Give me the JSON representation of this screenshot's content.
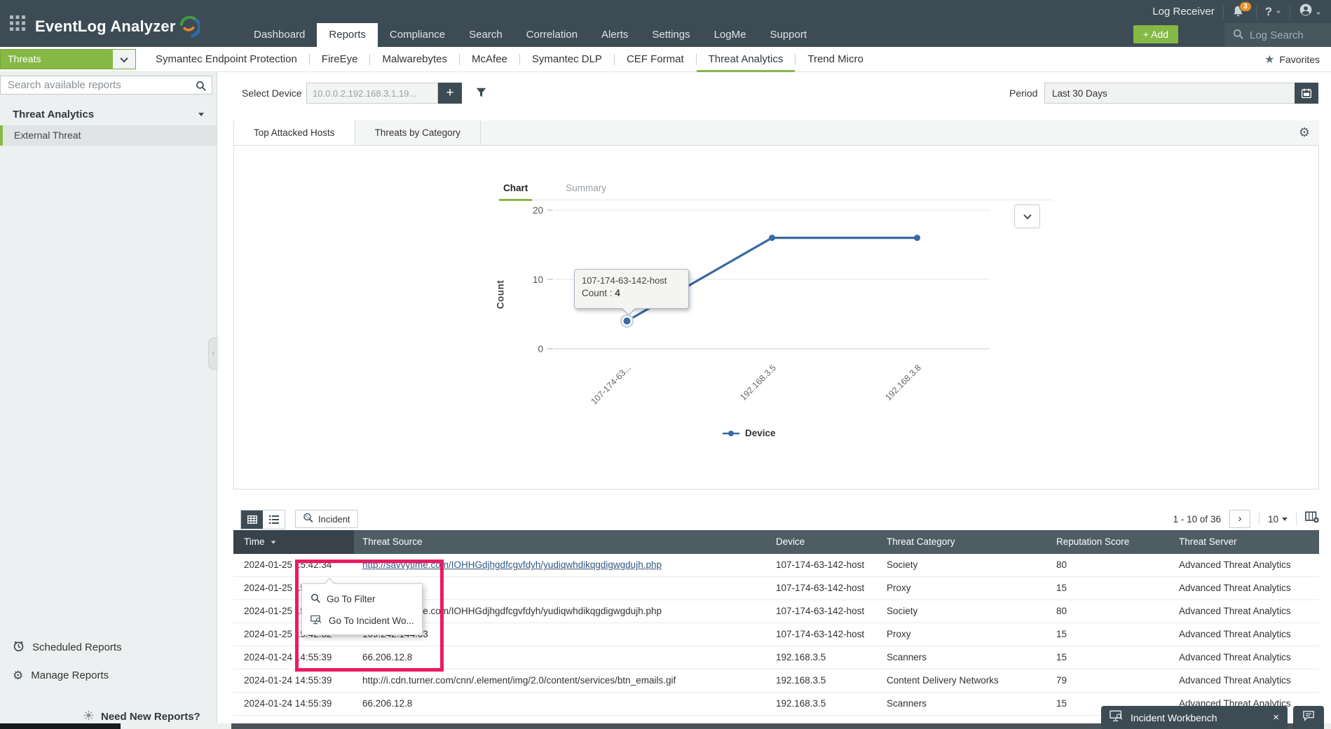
{
  "topbar": {
    "app_title": "EventLog Analyzer",
    "nav": [
      {
        "label": "Dashboard",
        "active": false
      },
      {
        "label": "Reports",
        "active": true
      },
      {
        "label": "Compliance",
        "active": false
      },
      {
        "label": "Search",
        "active": false
      },
      {
        "label": "Correlation",
        "active": false
      },
      {
        "label": "Alerts",
        "active": false
      },
      {
        "label": "Settings",
        "active": false
      },
      {
        "label": "LogMe",
        "active": false
      },
      {
        "label": "Support",
        "active": false
      }
    ],
    "log_receiver_label": "Log Receiver",
    "notification_count": "3",
    "help_label": "?",
    "add_label": "+  Add",
    "log_search_label": "Log Search"
  },
  "report_nav": {
    "selector_label": "Threats",
    "items": [
      {
        "label": "Symantec Endpoint Protection",
        "active": false
      },
      {
        "label": "FireEye",
        "active": false
      },
      {
        "label": "Malwarebytes",
        "active": false
      },
      {
        "label": "McAfee",
        "active": false
      },
      {
        "label": "Symantec DLP",
        "active": false
      },
      {
        "label": "CEF Format",
        "active": false
      },
      {
        "label": "Threat Analytics",
        "active": true
      },
      {
        "label": "Trend Micro",
        "active": false
      }
    ],
    "favorites_label": "Favorites",
    "star_icon": "★"
  },
  "sidebar": {
    "search_placeholder": "Search available reports",
    "section_title": "Threat Analytics",
    "items": [
      {
        "label": "External Threat",
        "selected": true
      }
    ],
    "footer_items": [
      {
        "label": "Scheduled Reports"
      },
      {
        "label": "Manage Reports"
      }
    ],
    "need_new_reports_label": "Need New Reports?"
  },
  "filters": {
    "select_device_label": "Select Device",
    "select_device_value": "10.0.0.2,192.168.3.1,19...",
    "add_device_label": "+",
    "period_label": "Period",
    "period_value": "Last 30 Days"
  },
  "view_tabs": [
    {
      "label": "Top Attacked Hosts",
      "active": true
    },
    {
      "label": "Threats by Category",
      "active": false
    }
  ],
  "chart_tabs": [
    "Chart",
    "Summary"
  ],
  "chart_data": {
    "type": "line",
    "title": "Top Attacked Hosts",
    "categories": [
      "107-174-63-142-host",
      "192.168.3.5",
      "192.168.3.8"
    ],
    "x_tick_labels": [
      "107-174-63...",
      "192.168.3.5",
      "192.168.3.8"
    ],
    "series": [
      {
        "name": "Device",
        "values": [
          4,
          16,
          16
        ]
      }
    ],
    "xlabel": "",
    "ylabel": "Count",
    "ylim": [
      0,
      20
    ],
    "yticks": [
      0,
      10,
      20
    ],
    "grid": true,
    "legend_position": "bottom",
    "line_color": "#3a69a5",
    "tooltip": {
      "title": "107-174-63-142-host",
      "label": "Count :",
      "value": "4"
    }
  },
  "table": {
    "toolbar": {
      "incident_label": "Incident",
      "pagination_text": "1 - 10 of 36",
      "next_label": "›",
      "page_size": "10"
    },
    "columns": [
      "Time",
      "Threat Source",
      "Device",
      "Threat Category",
      "Reputation Score",
      "Threat Server"
    ],
    "rows": [
      {
        "time": "2024-01-25 15:42:34",
        "source": "http://savvytime.com/IOHHGdjhgdfcgvfdyh/yudiqwhdikqgdigwgdujh.php",
        "device": "107-174-63-142-host",
        "category": "Society",
        "score": "80",
        "server": "Advanced Threat Analytics"
      },
      {
        "time": "2024-01-25 15:42:34",
        "source": "",
        "device": "107-174-63-142-host",
        "category": "Proxy",
        "score": "15",
        "server": "Advanced Threat Analytics"
      },
      {
        "time": "2024-01-25 15:42:32",
        "source": "http://savvytime.com/IOHHGdjhgdfcgvfdyh/yudiqwhdikqgdigwgdujh.php",
        "device": "107-174-63-142-host",
        "category": "Society",
        "score": "80",
        "server": "Advanced Threat Analytics"
      },
      {
        "time": "2024-01-25 15:42:32",
        "source": "109.242.144.63",
        "device": "107-174-63-142-host",
        "category": "Proxy",
        "score": "15",
        "server": "Advanced Threat Analytics"
      },
      {
        "time": "2024-01-24 14:55:39",
        "source": "66.206.12.8",
        "device": "192.168.3.5",
        "category": "Scanners",
        "score": "15",
        "server": "Advanced Threat Analytics"
      },
      {
        "time": "2024-01-24 14:55:39",
        "source": "http://i.cdn.turner.com/cnn/.element/img/2.0/content/services/btn_emails.gif",
        "device": "192.168.3.5",
        "category": "Content Delivery Networks",
        "score": "79",
        "server": "Advanced Threat Analytics"
      },
      {
        "time": "2024-01-24 14:55:39",
        "source": "66.206.12.8",
        "device": "192.168.3.5",
        "category": "Scanners",
        "score": "15",
        "server": "Advanced Threat Analytics"
      }
    ]
  },
  "context_menu": {
    "items": [
      {
        "label": "Go To Filter",
        "icon": "search-icon"
      },
      {
        "label": "Go To Incident Wo...",
        "icon": "incident-workbench-icon"
      }
    ]
  },
  "workbench": {
    "title": "Incident Workbench",
    "close_label": "×"
  },
  "colors": {
    "topbar": "#3d4c54",
    "accent_green": "#86b845",
    "line_blue": "#3a69a5",
    "annotation_pink": "#ed1a63",
    "table_header": "#4e5c64",
    "table_header_sorted": "#37424a",
    "link": "#35597f"
  }
}
